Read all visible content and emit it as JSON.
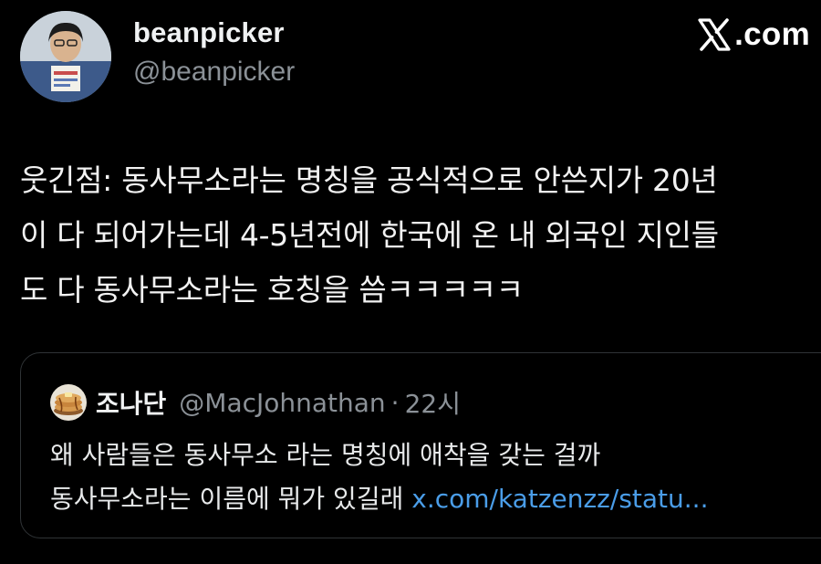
{
  "author": {
    "display_name": "beanpicker",
    "handle": "@beanpicker",
    "avatar_icon": "profile-photo-avatar"
  },
  "brand": {
    "mark": "x-logo",
    "domain": ".com"
  },
  "tweet": {
    "lines": [
      "웃긴점: 동사무소라는 명칭을 공식적으로 안쓴지가 20년",
      "이 다 되어가는데 4-5년전에 한국에 온 내 외국인 지인들",
      "도 다 동사무소라는 호칭을 씀ㅋㅋㅋㅋㅋ"
    ]
  },
  "quote": {
    "display_name": "조나단",
    "handle": "@MacJohnathan",
    "separator": "·",
    "time": "22시",
    "line1": "왜 사람들은 동사무소 라는 명칭에 애착을 갖는 걸까",
    "line2_text": "동사무소라는 이름에 뭐가 있길래 ",
    "line2_link": "x.com/katzenzz/statu..."
  },
  "colors": {
    "background": "#000000",
    "text_primary": "#e7e9ea",
    "text_secondary": "#8b9197",
    "link": "#4a9de8",
    "border": "#2f3336"
  }
}
